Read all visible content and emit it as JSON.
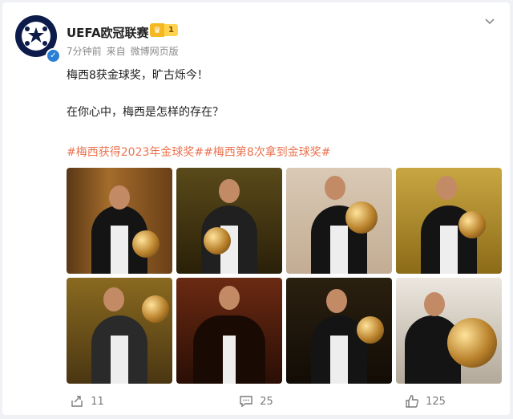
{
  "post": {
    "username": "UEFA欧冠联赛",
    "vip_level": "1",
    "time": "7分钟前",
    "source_prefix": "来自",
    "source": "微博网页版",
    "line1": "梅西8获金球奖，旷古烁今！",
    "line2": "在你心中，梅西是怎样的存在？",
    "hashtags": [
      "#梅西获得2023年金球奖#",
      "#梅西第8次拿到金球奖#"
    ]
  },
  "actions": {
    "share_count": "11",
    "comment_count": "25",
    "like_count": "125"
  },
  "icons": {
    "avatar": "ucl-starball-icon",
    "verified": "verified-icon",
    "vip": "crown-icon",
    "menu": "chevron-down-icon",
    "share": "share-icon",
    "comment": "comment-icon",
    "like": "thumbs-up-icon"
  },
  "colors": {
    "hashtag": "#eb7350",
    "verified": "#2a7fd4",
    "vip": "#f5b820"
  }
}
